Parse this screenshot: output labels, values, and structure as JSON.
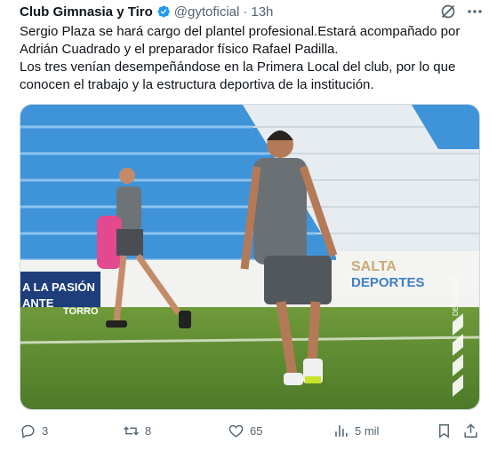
{
  "tweet": {
    "author_name": "Club Gimnasia y Tiro",
    "handle": "@gytoficial",
    "separator": "·",
    "time": "13h",
    "text_lines": [
      "Sergio Plaza se hará cargo del plantel profesional.Estará acompañado por",
      "Adrián Cuadrado y el preparador físico Rafael Padilla.",
      "Los tres venían desempeñándose en la Primera Local del club, por lo que",
      "conocen el trabajo y la estructura deportiva de la institución."
    ]
  },
  "media": {
    "banner_left_line1": "A LA PASIÓN",
    "banner_left_line2": "ANTE",
    "banner_left_brand": "TORRO",
    "banner_right_line1": "SALTA",
    "banner_right_line2": "DEPORTES",
    "watermark": "DEPORTES"
  },
  "actions": {
    "replies": "3",
    "reposts": "8",
    "likes": "65",
    "views": "5 mil"
  },
  "colors": {
    "accent": "#1d9bf0",
    "secondary_text": "#536471",
    "primary_text": "#0f1419"
  },
  "icons": [
    "verified-badge-icon",
    "grok-icon",
    "more-icon",
    "reply-icon",
    "repost-icon",
    "like-icon",
    "views-icon",
    "bookmark-icon",
    "share-icon"
  ]
}
